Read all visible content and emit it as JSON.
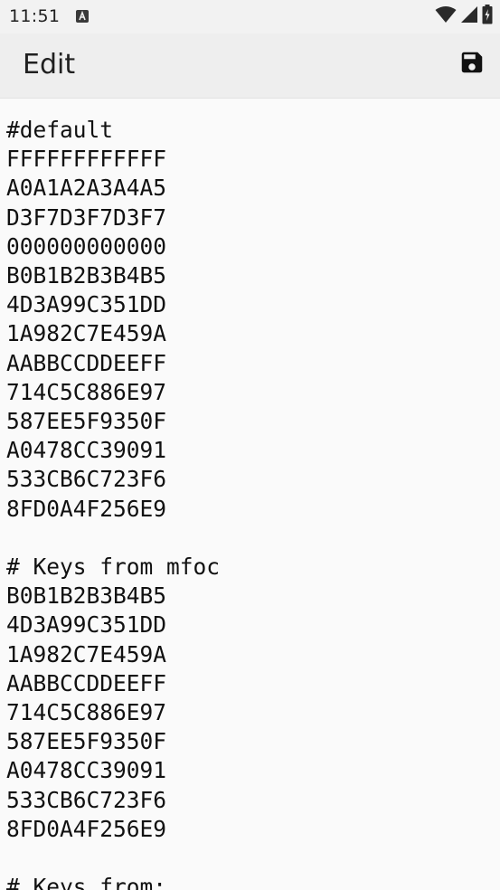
{
  "status_bar": {
    "time": "11:51",
    "notification_icon": "a-box-icon",
    "icons": [
      "wifi-icon",
      "cell-signal-icon",
      "battery-charging-icon"
    ]
  },
  "app_bar": {
    "title": "Edit",
    "save_icon": "save-icon"
  },
  "editor": {
    "lines": [
      "#default",
      "FFFFFFFFFFFF",
      "A0A1A2A3A4A5",
      "D3F7D3F7D3F7",
      "000000000000",
      "B0B1B2B3B4B5",
      "4D3A99C351DD",
      "1A982C7E459A",
      "AABBCCDDEEFF",
      "714C5C886E97",
      "587EE5F9350F",
      "A0478CC39091",
      "533CB6C723F6",
      "8FD0A4F256E9",
      "",
      "# Keys from mfoc",
      "B0B1B2B3B4B5",
      "4D3A99C351DD",
      "1A982C7E459A",
      "AABBCCDDEEFF",
      "714C5C886E97",
      "587EE5F9350F",
      "A0478CC39091",
      "533CB6C723F6",
      "8FD0A4F256E9",
      "",
      "# Keys from:"
    ]
  },
  "colors": {
    "status_bar_bg": "#f2f2f2",
    "app_bar_bg": "#eeeeee",
    "editor_bg": "#fafafa",
    "text": "#111111",
    "icon": "#111111"
  }
}
